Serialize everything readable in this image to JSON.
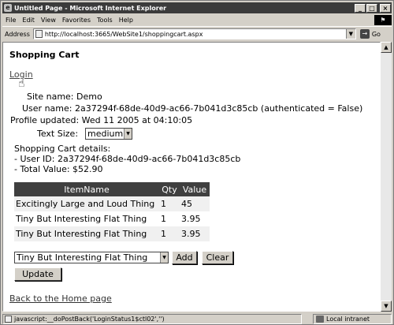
{
  "window": {
    "title": "Untitled Page - Microsoft Internet Explorer",
    "minimize": "_",
    "maximize": "□",
    "close": "×"
  },
  "menu": {
    "items": [
      "File",
      "Edit",
      "View",
      "Favorites",
      "Tools",
      "Help"
    ]
  },
  "address": {
    "label": "Address",
    "url": "http://localhost:3665/WebSite1/shoppingcart.aspx",
    "go_label": "Go"
  },
  "page": {
    "heading": "Shopping Cart",
    "login_link": "Login",
    "site_name_label": "Site name:",
    "site_name_value": "Demo",
    "user_name_label": "User name:",
    "user_name_value": "2a37294f-68de-40d9-ac66-7b041d3c85cb (authenticated = False)",
    "profile_updated_label": "Profile updated:",
    "profile_updated_value": "Wed 11 2005 at 04:10:05",
    "text_size_label": "Text Size:",
    "text_size_value": "medium",
    "details_title": "Shopping Cart details:",
    "details_user": "- User ID: 2a37294f-68de-40d9-ac66-7b041d3c85cb",
    "details_total": "- Total Value: $52.90",
    "table": {
      "headers": [
        "ItemName",
        "Qty",
        "Value"
      ],
      "rows": [
        [
          "Excitingly Large and Loud Thing",
          "1",
          "45"
        ],
        [
          "Tiny But Interesting Flat Thing",
          "1",
          "3.95"
        ],
        [
          "Tiny But Interesting Flat Thing",
          "1",
          "3.95"
        ]
      ]
    },
    "product_select": "Tiny But Interesting Flat Thing",
    "add_button": "Add",
    "clear_button": "Clear",
    "update_button": "Update",
    "home_link": "Back to the Home page"
  },
  "status": {
    "text": "javascript:__doPostBack('LoginStatus1$ctl02','')",
    "zone": "Local intranet"
  }
}
